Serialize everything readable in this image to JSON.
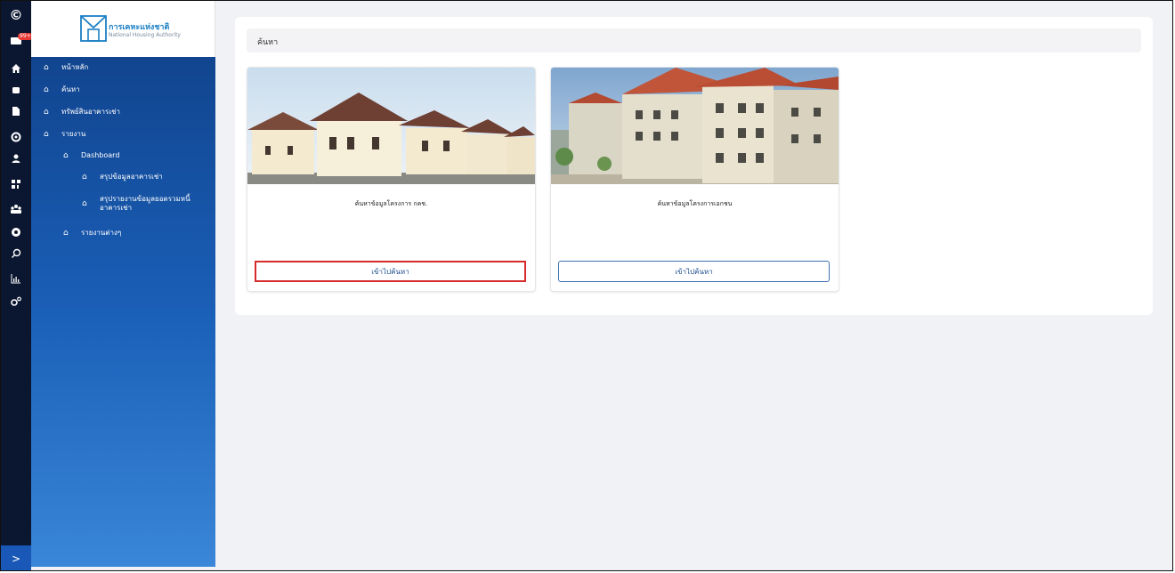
{
  "rail": {
    "top_label": "©",
    "badge": "99+",
    "expand_label": ">"
  },
  "brand": {
    "title": "การเคหะแห่งชาติ",
    "subtitle": "National Housing Authority"
  },
  "sidebar": {
    "items": [
      {
        "label": "หน้าหลัก"
      },
      {
        "label": "ค้นหา"
      },
      {
        "label": "ทรัพย์สินอาคารเช่า"
      },
      {
        "label": "รายงาน"
      },
      {
        "label": "Dashboard"
      },
      {
        "label": "สรุปข้อมูลอาคารเช่า"
      },
      {
        "label": "สรุปรายงานข้อมูลยอดรวมหนี้ อาคารเช่า"
      },
      {
        "label": "รายงานต่างๆ"
      }
    ]
  },
  "main": {
    "breadcrumb": "ค้นหา",
    "cards": [
      {
        "title": "ค้นหาข้อมูลโครงการ กคช.",
        "button_label": "เข้าไปค้นหา",
        "image": "townhouse-photo"
      },
      {
        "title": "ค้นหาข้อมูลโครงการเอกชน",
        "button_label": "เข้าไปค้นหา",
        "image": "apartment-building-photo"
      }
    ]
  },
  "colors": {
    "sidebar_top": "#0f3f86",
    "sidebar_bottom": "#3a86d8",
    "rail": "#0b1630",
    "highlight": "#d62b2b",
    "button_border": "#3f6fb0"
  }
}
